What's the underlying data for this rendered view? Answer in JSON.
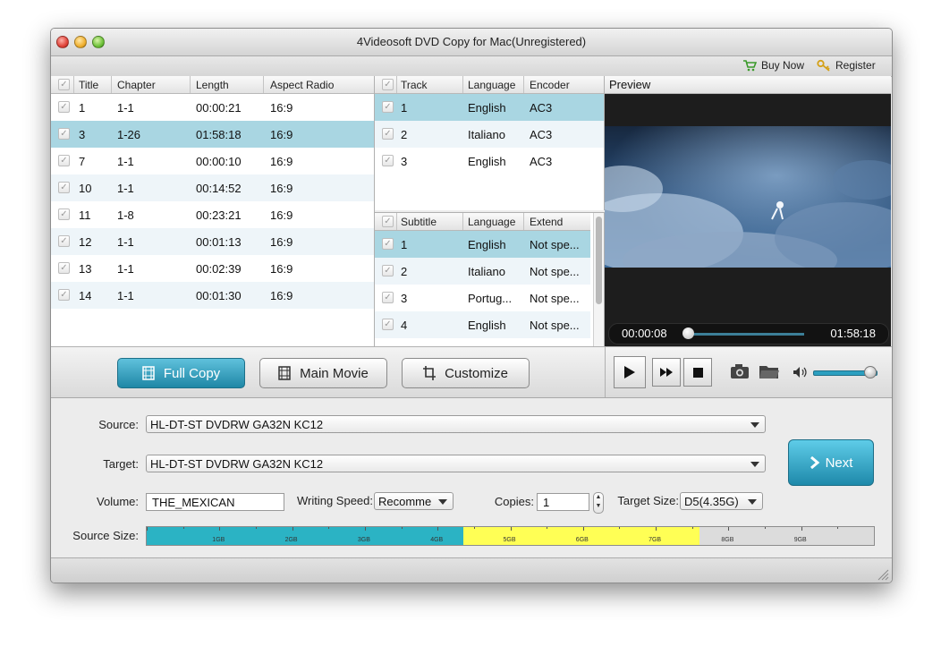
{
  "window": {
    "title": "4Videosoft DVD Copy for Mac(Unregistered)"
  },
  "toolbar": {
    "buy_now": "Buy Now",
    "register": "Register"
  },
  "titles_table": {
    "headers": [
      "Title",
      "Chapter",
      "Length",
      "Aspect Radio"
    ],
    "rows": [
      {
        "title": "1",
        "chapter": "1-1",
        "length": "00:00:21",
        "aspect": "16:9",
        "checked": true,
        "selected": false
      },
      {
        "title": "3",
        "chapter": "1-26",
        "length": "01:58:18",
        "aspect": "16:9",
        "checked": true,
        "selected": true
      },
      {
        "title": "7",
        "chapter": "1-1",
        "length": "00:00:10",
        "aspect": "16:9",
        "checked": true,
        "selected": false
      },
      {
        "title": "10",
        "chapter": "1-1",
        "length": "00:14:52",
        "aspect": "16:9",
        "checked": true,
        "selected": false
      },
      {
        "title": "11",
        "chapter": "1-8",
        "length": "00:23:21",
        "aspect": "16:9",
        "checked": true,
        "selected": false
      },
      {
        "title": "12",
        "chapter": "1-1",
        "length": "00:01:13",
        "aspect": "16:9",
        "checked": true,
        "selected": false
      },
      {
        "title": "13",
        "chapter": "1-1",
        "length": "00:02:39",
        "aspect": "16:9",
        "checked": true,
        "selected": false
      },
      {
        "title": "14",
        "chapter": "1-1",
        "length": "00:01:30",
        "aspect": "16:9",
        "checked": true,
        "selected": false
      }
    ]
  },
  "audio_table": {
    "headers": [
      "Track",
      "Language",
      "Encoder"
    ],
    "rows": [
      {
        "track": "1",
        "language": "English",
        "encoder": "AC3",
        "selected": true
      },
      {
        "track": "2",
        "language": "Italiano",
        "encoder": "AC3",
        "selected": false
      },
      {
        "track": "3",
        "language": "English",
        "encoder": "AC3",
        "selected": false
      }
    ]
  },
  "subtitle_table": {
    "headers": [
      "Subtitle",
      "Language",
      "Extend"
    ],
    "rows": [
      {
        "subtitle": "1",
        "language": "English",
        "extend": "Not spe...",
        "selected": true
      },
      {
        "subtitle": "2",
        "language": "Italiano",
        "extend": "Not spe...",
        "selected": false
      },
      {
        "subtitle": "3",
        "language": "Portug...",
        "extend": "Not spe...",
        "selected": false
      },
      {
        "subtitle": "4",
        "language": "English",
        "extend": "Not spe...",
        "selected": false
      }
    ]
  },
  "preview": {
    "label": "Preview",
    "current_time": "00:00:08",
    "total_time": "01:58:18",
    "progress": 0.0,
    "volume": 0.9
  },
  "modes": {
    "full_copy": "Full Copy",
    "main_movie": "Main Movie",
    "customize": "Customize",
    "active": "full_copy"
  },
  "settings": {
    "source_label": "Source:",
    "source_value": "HL-DT-ST DVDRW  GA32N KC12",
    "target_label": "Target:",
    "target_value": "HL-DT-ST DVDRW  GA32N KC12",
    "volume_label": "Volume:",
    "volume_value": "THE_MEXICAN",
    "writing_speed_label": "Writing Speed:",
    "writing_speed_value": "Recomme",
    "copies_label": "Copies:",
    "copies_value": "1",
    "target_size_label": "Target Size:",
    "target_size_value": "D5(4.35G)",
    "next_label": "Next",
    "source_size_label": "Source Size:"
  },
  "source_size": {
    "ticks": [
      "1GB",
      "2GB",
      "3GB",
      "4GB",
      "5GB",
      "6GB",
      "7GB",
      "8GB",
      "9GB"
    ],
    "segments": [
      {
        "from_gb": 0,
        "to_gb": 4.35,
        "color": "#2bb3c4"
      },
      {
        "from_gb": 4.35,
        "to_gb": 7.6,
        "color": "#ffff55"
      }
    ],
    "max_gb": 10
  },
  "colors": {
    "accent": "#1f87a6",
    "selected_row": "#a9d6e2"
  }
}
